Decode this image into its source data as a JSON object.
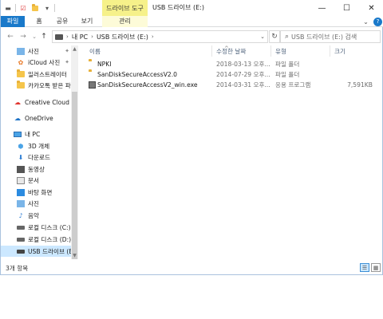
{
  "titlebar": {
    "context_tab_header": "드라이브 도구",
    "title": "USB 드라이브 (E:)",
    "minimize": "—",
    "maximize": "☐",
    "close": "✕"
  },
  "ribbon": {
    "tabs": [
      "파일",
      "홈",
      "공유",
      "보기",
      "관리"
    ]
  },
  "nav": {
    "breadcrumb": [
      "내 PC",
      "USB 드라이브 (E:)"
    ],
    "search_placeholder": "USB 드라이브 (E:) 검색"
  },
  "sidebar": {
    "items": [
      {
        "label": "사진",
        "icon": "pictures-icon",
        "pinned": true
      },
      {
        "label": "iCloud 사진",
        "icon": "icloud-photos-icon",
        "pinned": true
      },
      {
        "label": "일러스트레이터",
        "icon": "folder-icon",
        "pinned": false
      },
      {
        "label": "카카오톡 받은 파",
        "icon": "folder-icon",
        "pinned": false
      },
      {
        "label": "Creative Cloud Fil",
        "icon": "creative-cloud-icon",
        "pinned": false
      },
      {
        "label": "OneDrive",
        "icon": "onedrive-icon",
        "pinned": false
      },
      {
        "label": "내 PC",
        "icon": "pc-icon",
        "pinned": false
      },
      {
        "label": "3D 개체",
        "icon": "3d-objects-icon",
        "pinned": false
      },
      {
        "label": "다운로드",
        "icon": "downloads-icon",
        "pinned": false
      },
      {
        "label": "동영상",
        "icon": "videos-icon",
        "pinned": false
      },
      {
        "label": "문서",
        "icon": "documents-icon",
        "pinned": false
      },
      {
        "label": "바탕 화면",
        "icon": "desktop-icon",
        "pinned": false
      },
      {
        "label": "사진",
        "icon": "pictures-icon",
        "pinned": false
      },
      {
        "label": "음악",
        "icon": "music-icon",
        "pinned": false
      },
      {
        "label": "로컬 디스크 (C:)",
        "icon": "drive-icon",
        "pinned": false
      },
      {
        "label": "로컬 디스크 (D:)",
        "icon": "drive-icon",
        "pinned": false
      },
      {
        "label": "USB 드라이브 (E:)",
        "icon": "usb-drive-icon",
        "pinned": false,
        "selected": true
      }
    ]
  },
  "list": {
    "columns": [
      "이름",
      "수정한 날짜",
      "유형",
      "크기"
    ],
    "rows": [
      {
        "name": "NPKI",
        "date": "2018-03-13 오후...",
        "type": "파일 폴더",
        "size": "",
        "icon": "folder-icon"
      },
      {
        "name": "SanDiskSecureAccessV2.0",
        "date": "2014-07-29 오후...",
        "type": "파일 폴더",
        "size": "",
        "icon": "folder-icon"
      },
      {
        "name": "SanDiskSecureAccessV2_win.exe",
        "date": "2014-03-31 오후...",
        "type": "응용 프로그램",
        "size": "7,591KB",
        "icon": "application-icon"
      }
    ]
  },
  "status": {
    "item_count": "3개 항목"
  }
}
